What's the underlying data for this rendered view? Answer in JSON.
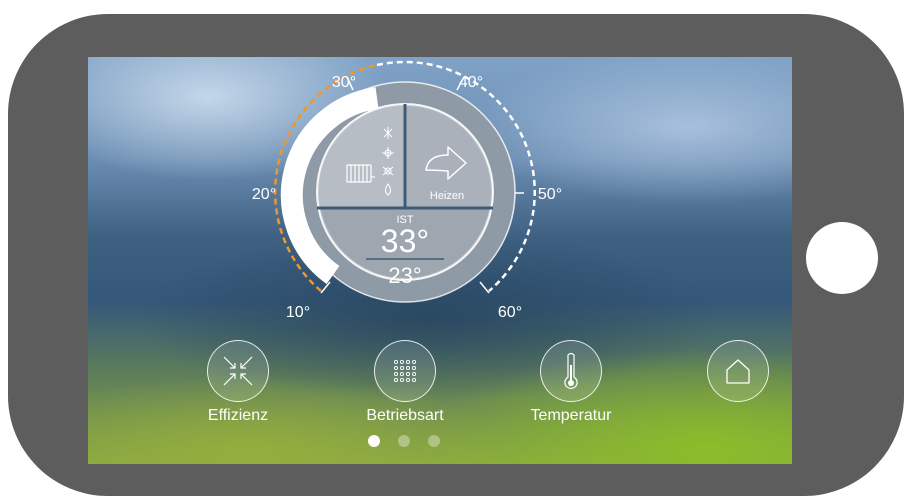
{
  "dial": {
    "scale_labels": [
      "10°",
      "20°",
      "30°",
      "40°",
      "50°",
      "60°"
    ],
    "mode_label": "Heizen",
    "ist_label": "IST",
    "current_temp": "33°",
    "target_temp": "23°"
  },
  "nav": [
    {
      "label": "Effizienz",
      "icon": "efficiency-icon"
    },
    {
      "label": "Betriebsart",
      "icon": "grid-icon"
    },
    {
      "label": "Temperatur",
      "icon": "thermometer-icon"
    },
    {
      "label": "",
      "icon": "home-icon"
    }
  ],
  "pagination": {
    "count": 3,
    "active": 1
  },
  "colors": {
    "frame": "#5d5d5d",
    "accent_orange": "#f0962a",
    "white": "#ffffff"
  }
}
